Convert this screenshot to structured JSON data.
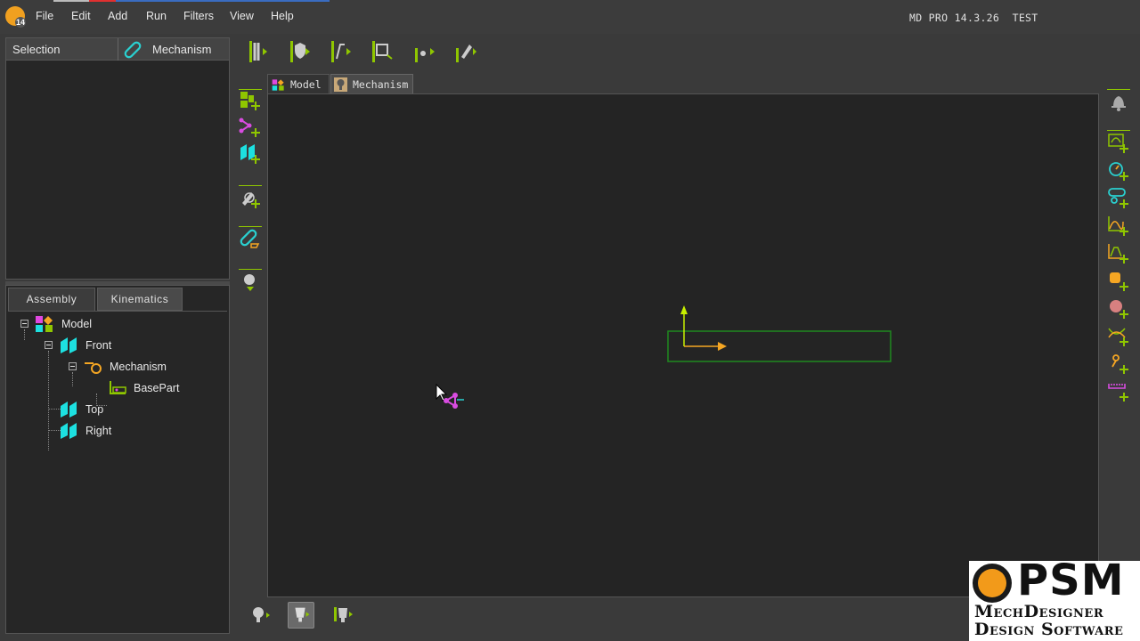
{
  "menubar": {
    "items": [
      "File",
      "Edit",
      "Add",
      "Run",
      "Filters",
      "View",
      "Help"
    ],
    "app_badge": "14",
    "version": "MD PRO 14.3.26",
    "mode": "TEST"
  },
  "selection_panel": {
    "title": "Selection",
    "active_filter": "Mechanism"
  },
  "tree_panel": {
    "tabs": [
      "Assembly",
      "Kinematics"
    ],
    "active_tab": "Assembly",
    "nodes": [
      {
        "label": "Model",
        "icon": "model-icon"
      },
      {
        "label": "Front",
        "icon": "plane-icon"
      },
      {
        "label": "Mechanism",
        "icon": "mechanism-icon"
      },
      {
        "label": "BasePart",
        "icon": "basepart-icon"
      },
      {
        "label": "Top",
        "icon": "plane-icon"
      },
      {
        "label": "Right",
        "icon": "plane-icon"
      }
    ]
  },
  "viewport_tabs": [
    "Model",
    "Mechanism"
  ],
  "active_viewport_tab": "Mechanism",
  "top_toolbar": [
    "gear-train-menu-icon",
    "shield-menu-icon",
    "line-menu-icon",
    "part-frame-menu-icon",
    "point-menu-icon",
    "pen-menu-icon"
  ],
  "left_toolbar": [
    "add-part-icon",
    "add-point-icon",
    "add-plane-icon",
    "edit-sketch-icon",
    "mechanism-link-icon",
    "solve-icon"
  ],
  "right_toolbar": [
    "bell-icon",
    "add-motion-icon",
    "add-speed-icon",
    "add-dyad-icon",
    "add-graph-icon",
    "add-cam-icon",
    "add-profile-icon",
    "add-3d-icon",
    "add-curve-icon",
    "add-joint-icon",
    "add-gear-icon"
  ],
  "bottom_toolbar": [
    "view-single-icon",
    "view-active-icon",
    "view-multi-icon"
  ],
  "colors": {
    "accent": "#8fc600",
    "plane": "#1de0e0",
    "frame_green": "#1f8a1f",
    "axis_orange": "#f5a623",
    "axis_yellow": "#c8f000",
    "point_magenta": "#d84ce0"
  },
  "branding": {
    "logo": "PSM",
    "line1": "MechDesigner",
    "line2": "Design Software"
  }
}
